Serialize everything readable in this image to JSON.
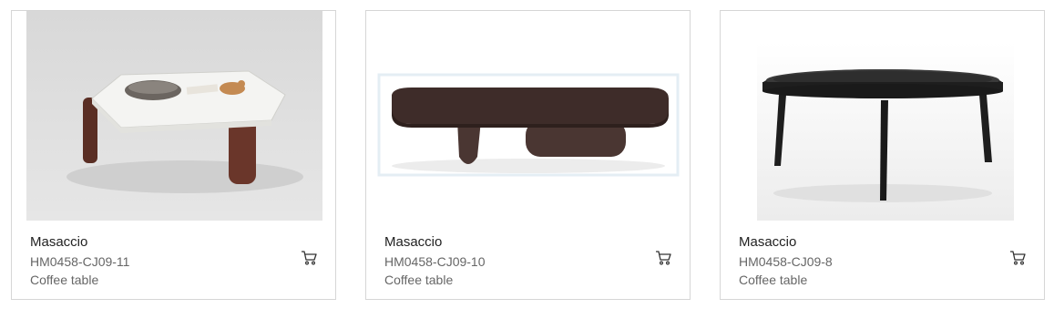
{
  "products": [
    {
      "name": "Masaccio",
      "code": "HM0458-CJ09-11",
      "category": "Coffee table",
      "image_icon": "coffee-table-white-top-image",
      "cart_icon": "cart-icon"
    },
    {
      "name": "Masaccio",
      "code": "HM0458-CJ09-10",
      "category": "Coffee table",
      "image_icon": "coffee-table-dark-wood-image",
      "cart_icon": "cart-icon"
    },
    {
      "name": "Masaccio",
      "code": "HM0458-CJ09-8",
      "category": "Coffee table",
      "image_icon": "coffee-table-round-black-image",
      "cart_icon": "cart-icon"
    }
  ],
  "colors": {
    "card_border": "#d6d6d6",
    "name_text": "#222222",
    "meta_text": "#666666"
  }
}
